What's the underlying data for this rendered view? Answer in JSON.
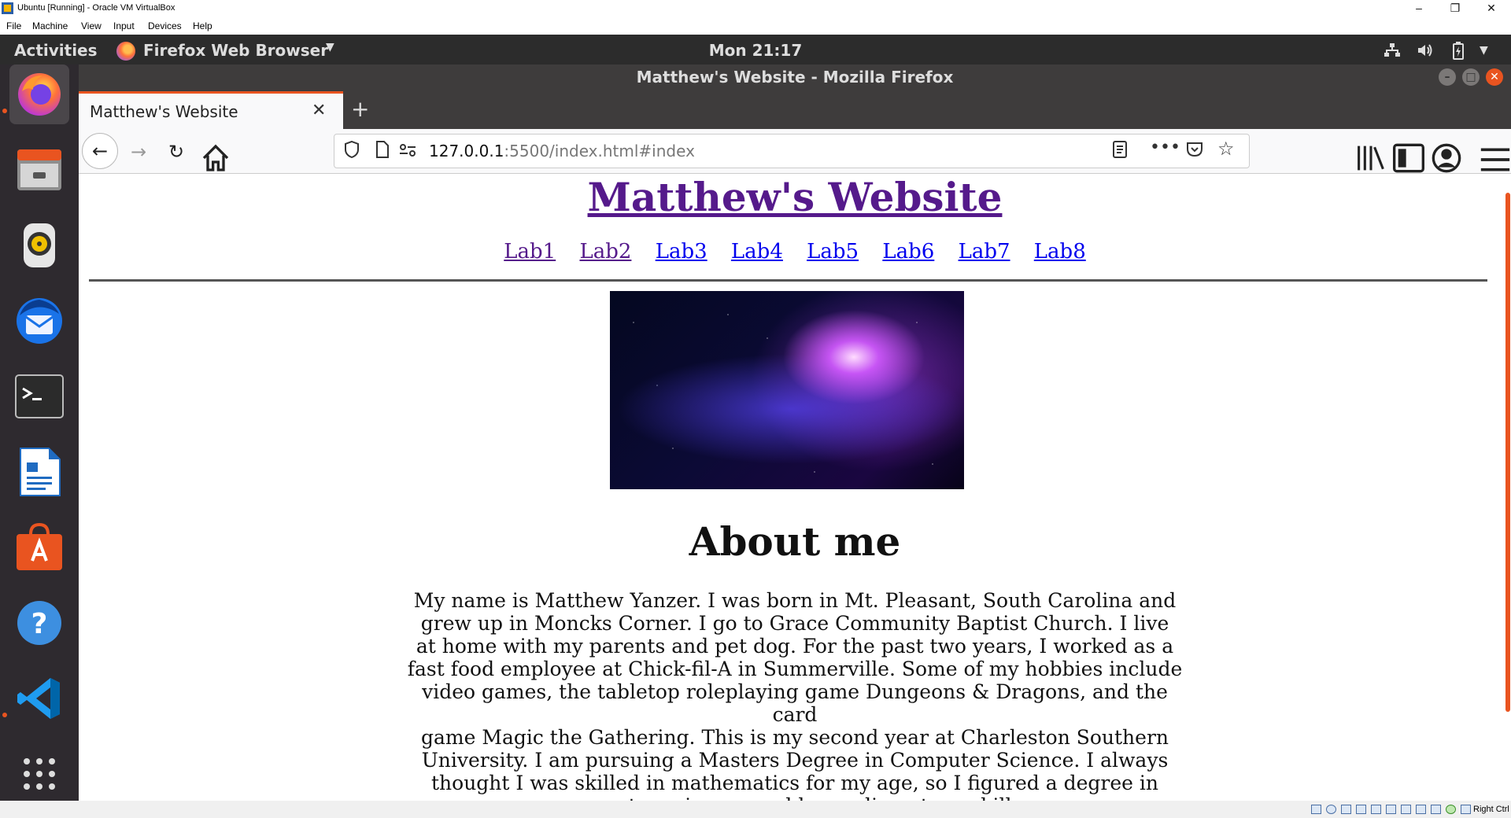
{
  "vbox": {
    "window_title": "Ubuntu [Running] - Oracle VM VirtualBox",
    "menu": [
      "File",
      "Machine",
      "View",
      "Input",
      "Devices",
      "Help"
    ],
    "minimize": "–",
    "restore": "❐",
    "close": "✕",
    "host_key": "Right Ctrl"
  },
  "ubuntu_topbar": {
    "activities": "Activities",
    "app_menu": "Firefox Web Browser",
    "clock": "Mon 21:17"
  },
  "dock": {
    "items": [
      "firefox",
      "files",
      "rhythmbox",
      "thunderbird",
      "terminal",
      "libreoffice-writer",
      "ubuntu-software",
      "help",
      "vscode",
      "show-applications"
    ]
  },
  "firefox": {
    "window_title": "Matthew's Website - Mozilla Firefox",
    "tab_title": "Matthew's Website",
    "url_host": "127.0.0.1",
    "url_rest": ":5500/index.html#index"
  },
  "page": {
    "site_title": "Matthew's Website",
    "nav_links": [
      "Lab1",
      "Lab2",
      "Lab3",
      "Lab4",
      "Lab5",
      "Lab6",
      "Lab7",
      "Lab8"
    ],
    "visited_links": [
      "Lab1",
      "Lab2"
    ],
    "about_heading": "About me",
    "bio_lines": [
      "My name is Matthew Yanzer. I was born in Mt. Pleasant, South Carolina and",
      "grew up in Moncks Corner. I go to Grace Community Baptist Church. I live",
      "at home with my parents and pet dog. For the past two years, I worked as a",
      "fast food employee at Chick-fil-A in Summerville. Some of my hobbies include",
      "video games, the tabletop roleplaying game Dungeons & Dragons, and the card",
      "game Magic the Gathering. This is my second year at Charleston Southern",
      "University. I am pursuing a Masters Degree in Computer Science. I always",
      "thought I was skilled in mathematics for my age, so I figured a degree in",
      "computer science would compliment my skills."
    ]
  },
  "colors": {
    "ubuntu_orange": "#e95420",
    "visited_link": "#551a8b",
    "link": "#0000ee"
  }
}
